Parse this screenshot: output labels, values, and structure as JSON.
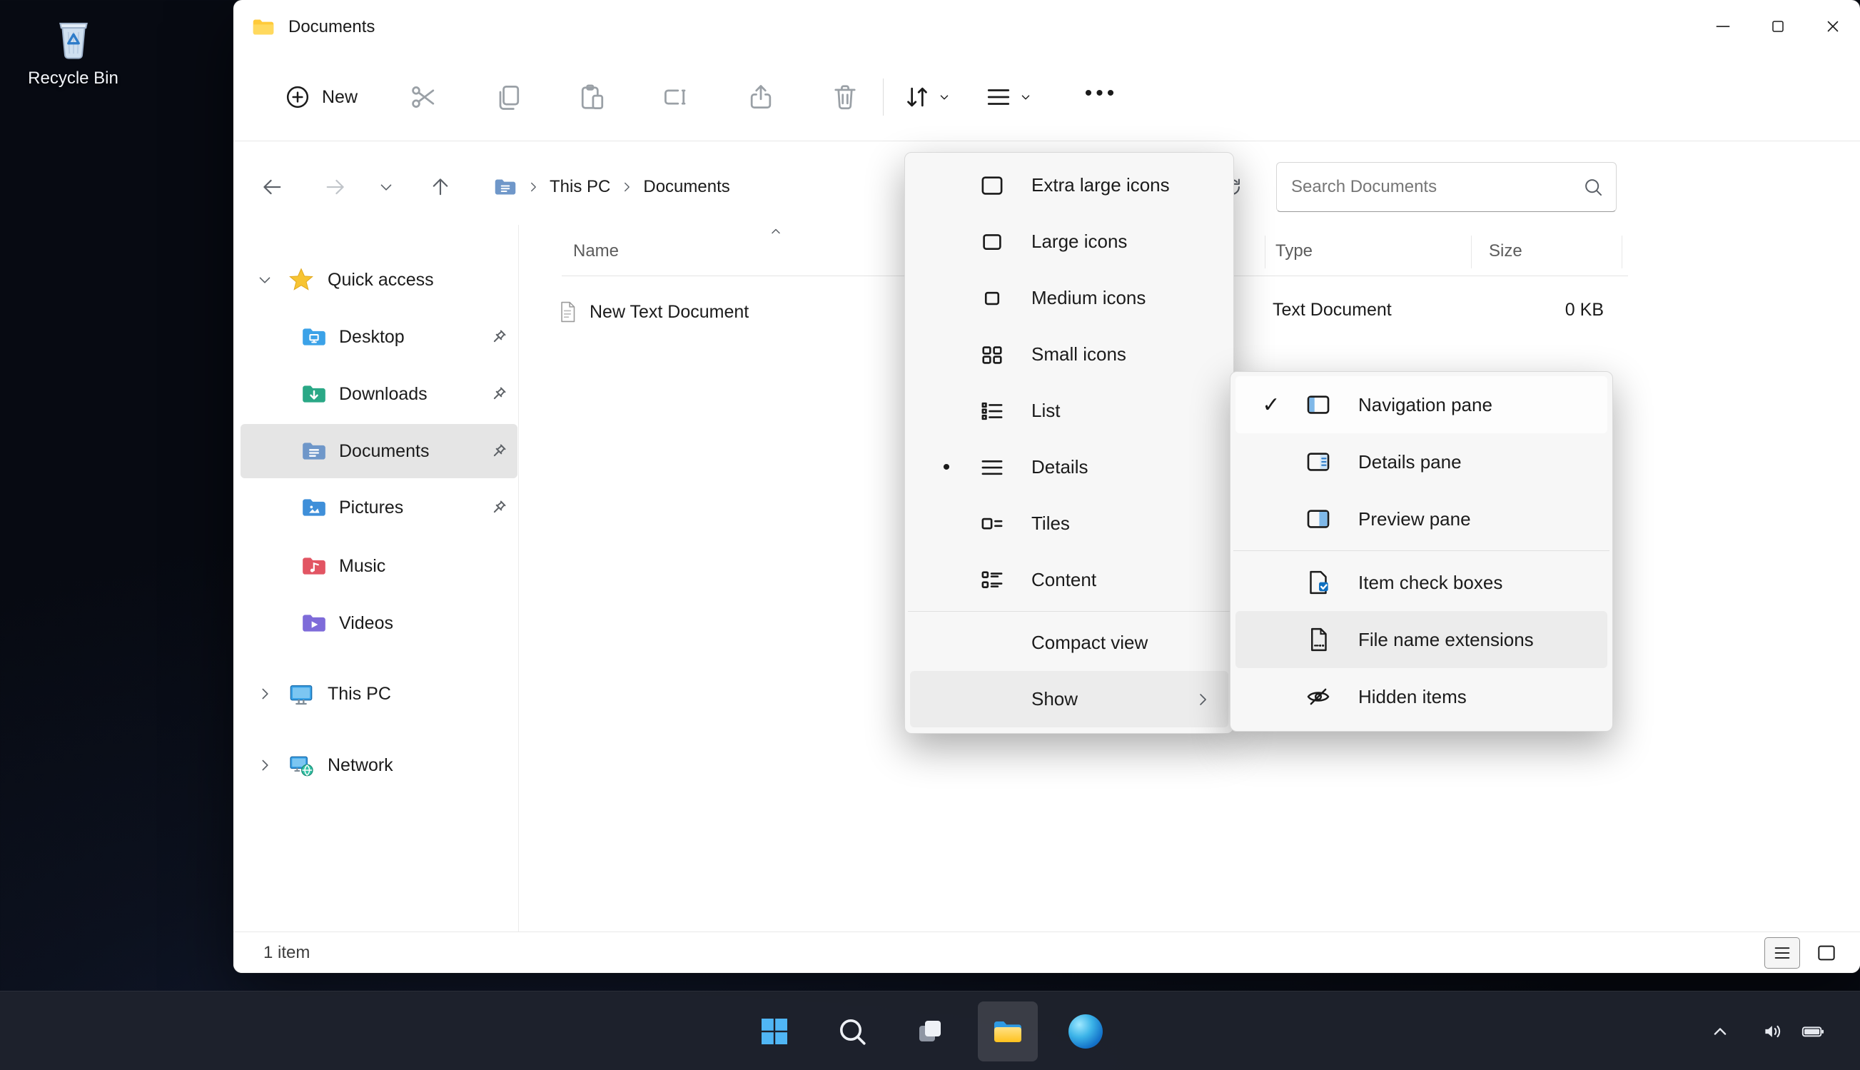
{
  "desktop": {
    "recycle_bin_label": "Recycle Bin"
  },
  "titlebar": {
    "title": "Documents"
  },
  "toolbar": {
    "new_label": "New"
  },
  "navbar": {
    "breadcrumb": [
      "This PC",
      "Documents"
    ],
    "search_placeholder": "Search Documents"
  },
  "sidebar": {
    "quick_access_label": "Quick access",
    "quick_access_items": [
      {
        "label": "Desktop",
        "pinned": true,
        "selected": false
      },
      {
        "label": "Downloads",
        "pinned": true,
        "selected": false
      },
      {
        "label": "Documents",
        "pinned": true,
        "selected": true
      },
      {
        "label": "Pictures",
        "pinned": true,
        "selected": false
      },
      {
        "label": "Music",
        "pinned": false,
        "selected": false
      },
      {
        "label": "Videos",
        "pinned": false,
        "selected": false
      }
    ],
    "this_pc_label": "This PC",
    "network_label": "Network"
  },
  "file_list": {
    "columns": {
      "name": "Name",
      "type": "Type",
      "size": "Size"
    },
    "rows": [
      {
        "name": "New Text Document",
        "type": "Text Document",
        "size": "0 KB"
      }
    ]
  },
  "status_bar": {
    "item_count": "1 item"
  },
  "view_menu": {
    "items": [
      {
        "label": "Extra large icons",
        "selected": false
      },
      {
        "label": "Large icons",
        "selected": false
      },
      {
        "label": "Medium icons",
        "selected": false
      },
      {
        "label": "Small icons",
        "selected": false
      },
      {
        "label": "List",
        "selected": false
      },
      {
        "label": "Details",
        "selected": true
      },
      {
        "label": "Tiles",
        "selected": false
      },
      {
        "label": "Content",
        "selected": false
      }
    ],
    "compact_view_label": "Compact view",
    "show_label": "Show"
  },
  "show_submenu": {
    "items": [
      {
        "label": "Navigation pane",
        "checked": true,
        "highlighted": false
      },
      {
        "label": "Details pane",
        "checked": false,
        "highlighted": false
      },
      {
        "label": "Preview pane",
        "checked": false,
        "highlighted": false
      },
      {
        "label": "Item check boxes",
        "checked": false,
        "highlighted": false
      },
      {
        "label": "File name extensions",
        "checked": false,
        "highlighted": true
      },
      {
        "label": "Hidden items",
        "checked": false,
        "highlighted": false
      }
    ]
  },
  "glyphs": {
    "ellipsis": "•••",
    "details_bullet": "•",
    "checkmark": "✓"
  },
  "colors": {
    "selection_gray": "#e5e5e5",
    "menu_bg": "#f7f7f7",
    "taskbar_bg": "#1e222c",
    "folder_yellow": "#ffc83d",
    "windows_blue": "#50b6f5",
    "accent_blue": "#0e6fc0"
  }
}
